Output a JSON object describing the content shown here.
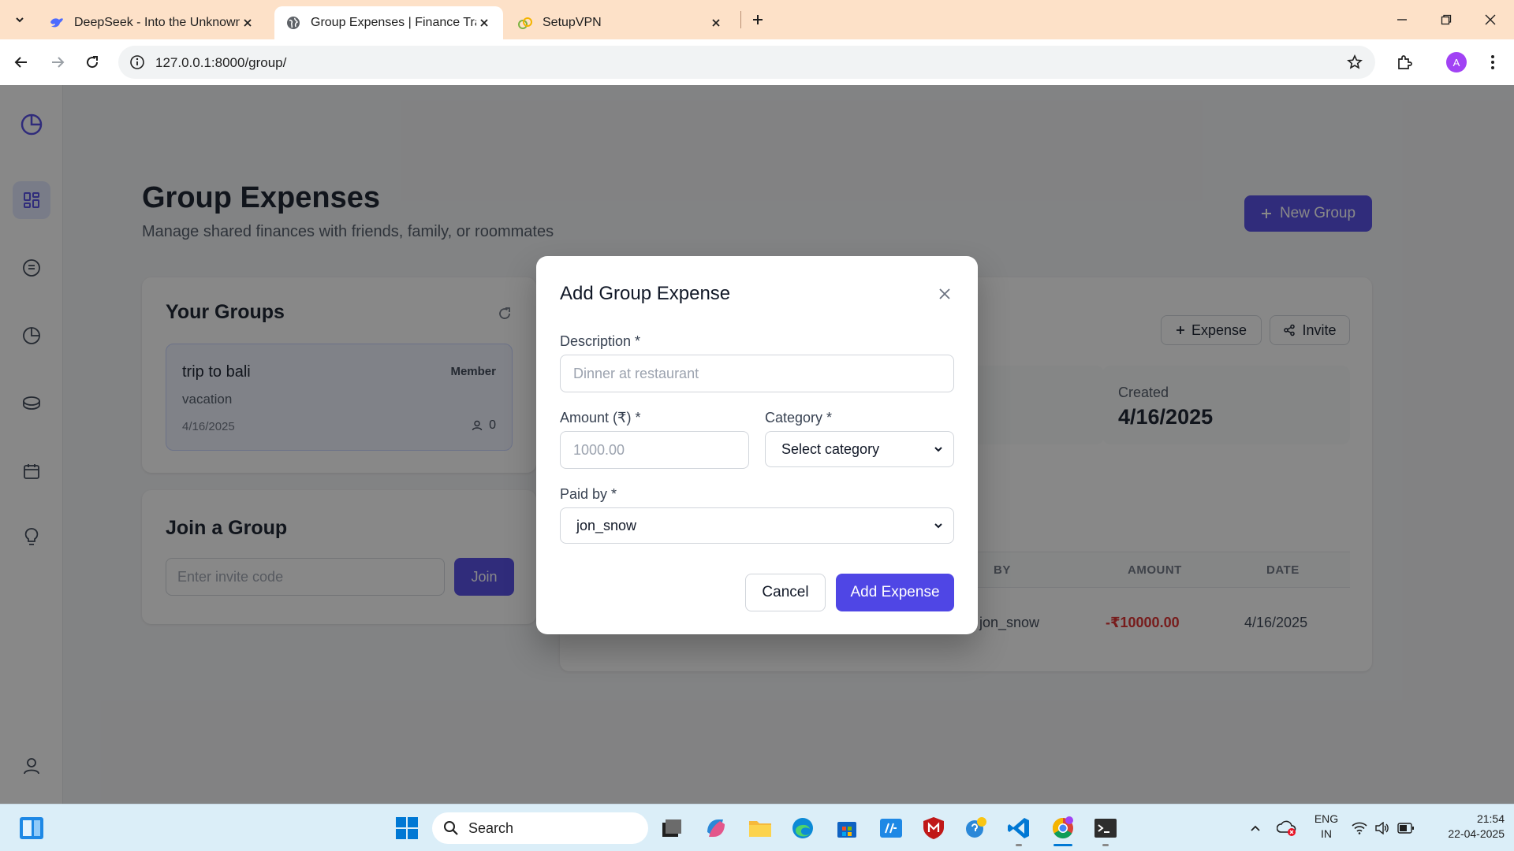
{
  "browser": {
    "tabs": [
      {
        "label": "DeepSeek - Into the Unknown",
        "favicon": "deepseek-icon"
      },
      {
        "label": "Group Expenses | Finance Track",
        "favicon": "globe-icon",
        "active": true
      },
      {
        "label": "SetupVPN",
        "favicon": "vpn-icon"
      }
    ],
    "url": "127.0.0.1:8000/group/",
    "profile_initial": "A"
  },
  "page": {
    "title": "Group Expenses",
    "subtitle": "Manage shared finances with friends, family, or roommates",
    "new_group_label": "New Group"
  },
  "groups_card": {
    "title": "Your Groups",
    "items": [
      {
        "name": "trip to bali",
        "role": "Member",
        "category": "vacation",
        "date": "4/16/2025",
        "members": "0"
      }
    ]
  },
  "join_card": {
    "title": "Join a Group",
    "placeholder": "Enter invite code",
    "button": "Join"
  },
  "details": {
    "expense_label": "Expense",
    "invite_label": "Invite",
    "created_label": "Created",
    "created_value": "4/16/2025",
    "columns": [
      "BY",
      "AMOUNT",
      "DATE"
    ],
    "rows": [
      {
        "by": "jon_snow",
        "amount": "-₹10000.00",
        "date": "4/16/2025"
      }
    ],
    "negative_color": "#dc2626"
  },
  "modal": {
    "title": "Add Group Expense",
    "description_label": "Description *",
    "description_placeholder": "Dinner at restaurant",
    "amount_label": "Amount (₹) *",
    "amount_placeholder": "1000.00",
    "category_label": "Category *",
    "category_value": "Select category",
    "paid_by_label": "Paid by *",
    "paid_by_value": "jon_snow",
    "cancel_label": "Cancel",
    "submit_label": "Add Expense"
  },
  "taskbar": {
    "search_label": "Search",
    "lang_top": "ENG",
    "lang_bottom": "IN",
    "time": "21:54",
    "date": "22-04-2025"
  },
  "colors": {
    "accent": "#4f46e5",
    "tabstrip": "#fde1c8"
  }
}
